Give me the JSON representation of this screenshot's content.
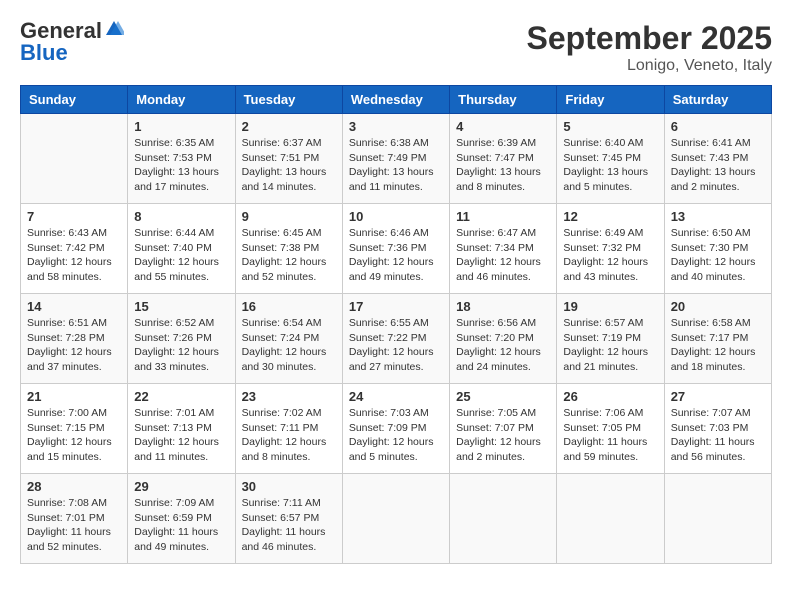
{
  "header": {
    "logo_general": "General",
    "logo_blue": "Blue",
    "month_title": "September 2025",
    "location": "Lonigo, Veneto, Italy"
  },
  "weekdays": [
    "Sunday",
    "Monday",
    "Tuesday",
    "Wednesday",
    "Thursday",
    "Friday",
    "Saturday"
  ],
  "weeks": [
    [
      {
        "day": "",
        "sunrise": "",
        "sunset": "",
        "daylight": ""
      },
      {
        "day": "1",
        "sunrise": "Sunrise: 6:35 AM",
        "sunset": "Sunset: 7:53 PM",
        "daylight": "Daylight: 13 hours and 17 minutes."
      },
      {
        "day": "2",
        "sunrise": "Sunrise: 6:37 AM",
        "sunset": "Sunset: 7:51 PM",
        "daylight": "Daylight: 13 hours and 14 minutes."
      },
      {
        "day": "3",
        "sunrise": "Sunrise: 6:38 AM",
        "sunset": "Sunset: 7:49 PM",
        "daylight": "Daylight: 13 hours and 11 minutes."
      },
      {
        "day": "4",
        "sunrise": "Sunrise: 6:39 AM",
        "sunset": "Sunset: 7:47 PM",
        "daylight": "Daylight: 13 hours and 8 minutes."
      },
      {
        "day": "5",
        "sunrise": "Sunrise: 6:40 AM",
        "sunset": "Sunset: 7:45 PM",
        "daylight": "Daylight: 13 hours and 5 minutes."
      },
      {
        "day": "6",
        "sunrise": "Sunrise: 6:41 AM",
        "sunset": "Sunset: 7:43 PM",
        "daylight": "Daylight: 13 hours and 2 minutes."
      }
    ],
    [
      {
        "day": "7",
        "sunrise": "Sunrise: 6:43 AM",
        "sunset": "Sunset: 7:42 PM",
        "daylight": "Daylight: 12 hours and 58 minutes."
      },
      {
        "day": "8",
        "sunrise": "Sunrise: 6:44 AM",
        "sunset": "Sunset: 7:40 PM",
        "daylight": "Daylight: 12 hours and 55 minutes."
      },
      {
        "day": "9",
        "sunrise": "Sunrise: 6:45 AM",
        "sunset": "Sunset: 7:38 PM",
        "daylight": "Daylight: 12 hours and 52 minutes."
      },
      {
        "day": "10",
        "sunrise": "Sunrise: 6:46 AM",
        "sunset": "Sunset: 7:36 PM",
        "daylight": "Daylight: 12 hours and 49 minutes."
      },
      {
        "day": "11",
        "sunrise": "Sunrise: 6:47 AM",
        "sunset": "Sunset: 7:34 PM",
        "daylight": "Daylight: 12 hours and 46 minutes."
      },
      {
        "day": "12",
        "sunrise": "Sunrise: 6:49 AM",
        "sunset": "Sunset: 7:32 PM",
        "daylight": "Daylight: 12 hours and 43 minutes."
      },
      {
        "day": "13",
        "sunrise": "Sunrise: 6:50 AM",
        "sunset": "Sunset: 7:30 PM",
        "daylight": "Daylight: 12 hours and 40 minutes."
      }
    ],
    [
      {
        "day": "14",
        "sunrise": "Sunrise: 6:51 AM",
        "sunset": "Sunset: 7:28 PM",
        "daylight": "Daylight: 12 hours and 37 minutes."
      },
      {
        "day": "15",
        "sunrise": "Sunrise: 6:52 AM",
        "sunset": "Sunset: 7:26 PM",
        "daylight": "Daylight: 12 hours and 33 minutes."
      },
      {
        "day": "16",
        "sunrise": "Sunrise: 6:54 AM",
        "sunset": "Sunset: 7:24 PM",
        "daylight": "Daylight: 12 hours and 30 minutes."
      },
      {
        "day": "17",
        "sunrise": "Sunrise: 6:55 AM",
        "sunset": "Sunset: 7:22 PM",
        "daylight": "Daylight: 12 hours and 27 minutes."
      },
      {
        "day": "18",
        "sunrise": "Sunrise: 6:56 AM",
        "sunset": "Sunset: 7:20 PM",
        "daylight": "Daylight: 12 hours and 24 minutes."
      },
      {
        "day": "19",
        "sunrise": "Sunrise: 6:57 AM",
        "sunset": "Sunset: 7:19 PM",
        "daylight": "Daylight: 12 hours and 21 minutes."
      },
      {
        "day": "20",
        "sunrise": "Sunrise: 6:58 AM",
        "sunset": "Sunset: 7:17 PM",
        "daylight": "Daylight: 12 hours and 18 minutes."
      }
    ],
    [
      {
        "day": "21",
        "sunrise": "Sunrise: 7:00 AM",
        "sunset": "Sunset: 7:15 PM",
        "daylight": "Daylight: 12 hours and 15 minutes."
      },
      {
        "day": "22",
        "sunrise": "Sunrise: 7:01 AM",
        "sunset": "Sunset: 7:13 PM",
        "daylight": "Daylight: 12 hours and 11 minutes."
      },
      {
        "day": "23",
        "sunrise": "Sunrise: 7:02 AM",
        "sunset": "Sunset: 7:11 PM",
        "daylight": "Daylight: 12 hours and 8 minutes."
      },
      {
        "day": "24",
        "sunrise": "Sunrise: 7:03 AM",
        "sunset": "Sunset: 7:09 PM",
        "daylight": "Daylight: 12 hours and 5 minutes."
      },
      {
        "day": "25",
        "sunrise": "Sunrise: 7:05 AM",
        "sunset": "Sunset: 7:07 PM",
        "daylight": "Daylight: 12 hours and 2 minutes."
      },
      {
        "day": "26",
        "sunrise": "Sunrise: 7:06 AM",
        "sunset": "Sunset: 7:05 PM",
        "daylight": "Daylight: 11 hours and 59 minutes."
      },
      {
        "day": "27",
        "sunrise": "Sunrise: 7:07 AM",
        "sunset": "Sunset: 7:03 PM",
        "daylight": "Daylight: 11 hours and 56 minutes."
      }
    ],
    [
      {
        "day": "28",
        "sunrise": "Sunrise: 7:08 AM",
        "sunset": "Sunset: 7:01 PM",
        "daylight": "Daylight: 11 hours and 52 minutes."
      },
      {
        "day": "29",
        "sunrise": "Sunrise: 7:09 AM",
        "sunset": "Sunset: 6:59 PM",
        "daylight": "Daylight: 11 hours and 49 minutes."
      },
      {
        "day": "30",
        "sunrise": "Sunrise: 7:11 AM",
        "sunset": "Sunset: 6:57 PM",
        "daylight": "Daylight: 11 hours and 46 minutes."
      },
      {
        "day": "",
        "sunrise": "",
        "sunset": "",
        "daylight": ""
      },
      {
        "day": "",
        "sunrise": "",
        "sunset": "",
        "daylight": ""
      },
      {
        "day": "",
        "sunrise": "",
        "sunset": "",
        "daylight": ""
      },
      {
        "day": "",
        "sunrise": "",
        "sunset": "",
        "daylight": ""
      }
    ]
  ]
}
